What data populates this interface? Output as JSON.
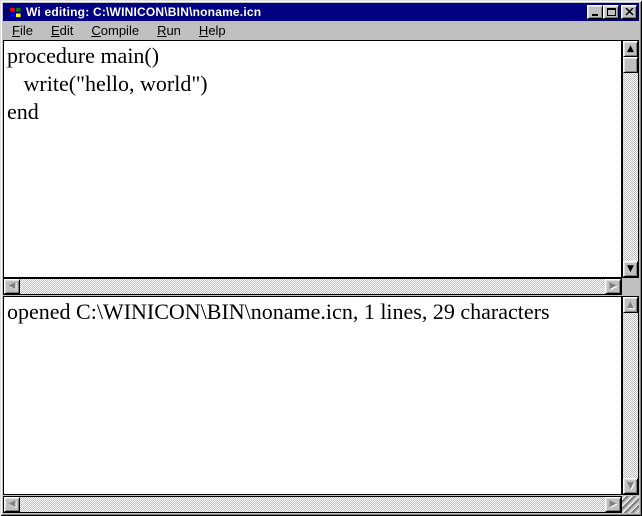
{
  "window": {
    "title": "Wi editing: C:\\WINICON\\BIN\\noname.icn",
    "app_icon": "wi-windows-flag-icon",
    "controls": {
      "minimize": "minimize-icon",
      "maximize": "maximize-icon",
      "close": "close-icon"
    },
    "titlebar_color": "#000080",
    "chrome_color": "#c0c0c0"
  },
  "menu": {
    "items": [
      {
        "label": "File"
      },
      {
        "label": "Edit"
      },
      {
        "label": "Compile"
      },
      {
        "label": "Run"
      },
      {
        "label": "Help"
      }
    ]
  },
  "editor": {
    "lines": [
      "procedure main()",
      "   write(\"hello, world\")",
      "end"
    ]
  },
  "output": {
    "message": "opened C:\\WINICON\\BIN\\noname.icn, 1 lines, 29 characters"
  },
  "icons": {
    "up": "▲",
    "down": "▼",
    "left": "◀",
    "right": "▶"
  }
}
